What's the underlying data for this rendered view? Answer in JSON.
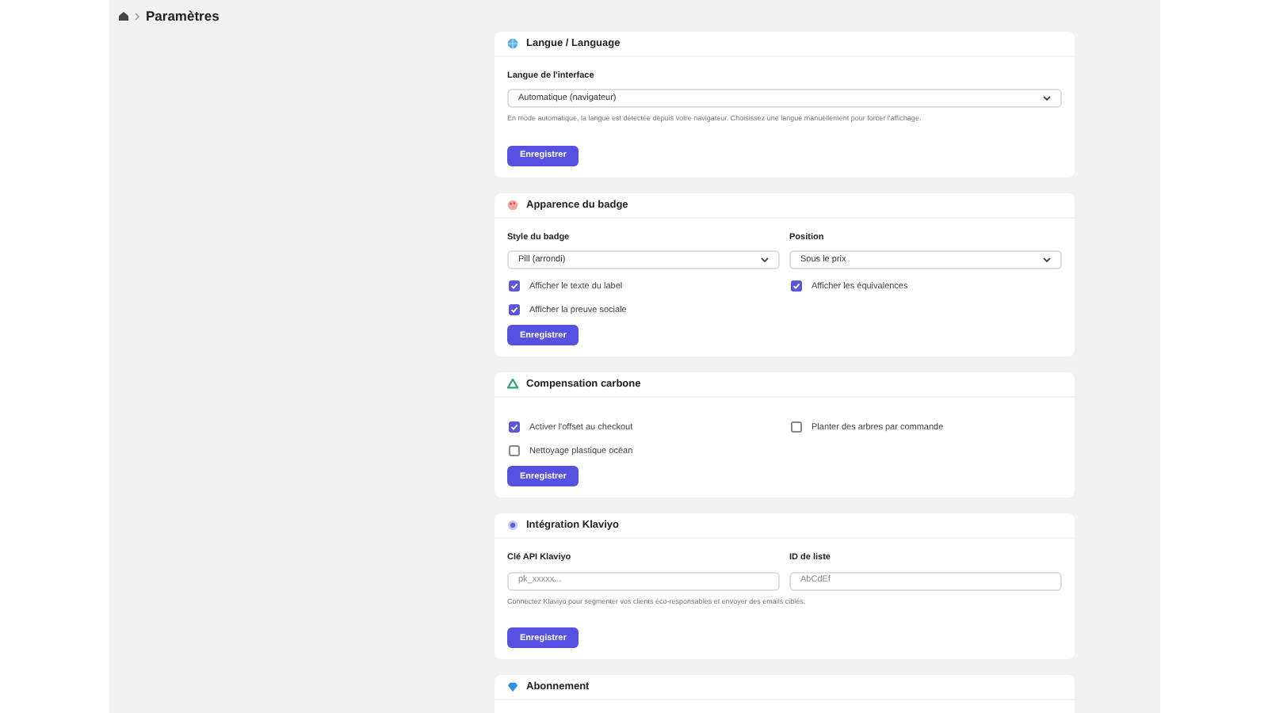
{
  "breadcrumb": {
    "current": "Paramètres"
  },
  "sections": [
    {
      "title": "Langue / Language",
      "fields": [
        {
          "kind": "select",
          "label": "Langue de l'interface",
          "value": "Automatique (navigateur)"
        }
      ],
      "hint": "En mode automatique, la langue est détectée depuis votre navigateur. Choisissez une langue manuellement pour forcer l'affichage.",
      "button": "Enregistrer"
    },
    {
      "title": "Apparence du badge",
      "fields": [
        {
          "kind": "select",
          "label": "Style du badge",
          "value": "Pill (arrondi)"
        },
        {
          "kind": "select",
          "label": "Position",
          "value": "Sous le prix"
        }
      ],
      "checkboxes": [
        {
          "label": "Afficher le texte du label",
          "checked": true
        },
        {
          "label": "Afficher les équivalences",
          "checked": true
        },
        {
          "label": "Afficher la preuve sociale",
          "checked": true
        }
      ],
      "button": "Enregistrer"
    },
    {
      "title": "Compensation carbone",
      "checkboxes": [
        {
          "label": "Activer l'offset au checkout",
          "checked": true
        },
        {
          "label": "Planter des arbres par commande",
          "checked": false
        },
        {
          "label": "Nettoyage plastique océan",
          "checked": false
        }
      ],
      "button": "Enregistrer"
    },
    {
      "title": "Intégration Klaviyo",
      "fields": [
        {
          "kind": "input",
          "label": "Clé API Klaviyo",
          "placeholder": "pk_xxxxx..."
        },
        {
          "kind": "input",
          "label": "ID de liste",
          "placeholder": "AbCdEf"
        }
      ],
      "hint": "Connectez Klaviyo pour segmenter vos clients éco-responsables et envoyer des emails ciblés.",
      "button": "Enregistrer"
    },
    {
      "title": "Abonnement"
    }
  ]
}
